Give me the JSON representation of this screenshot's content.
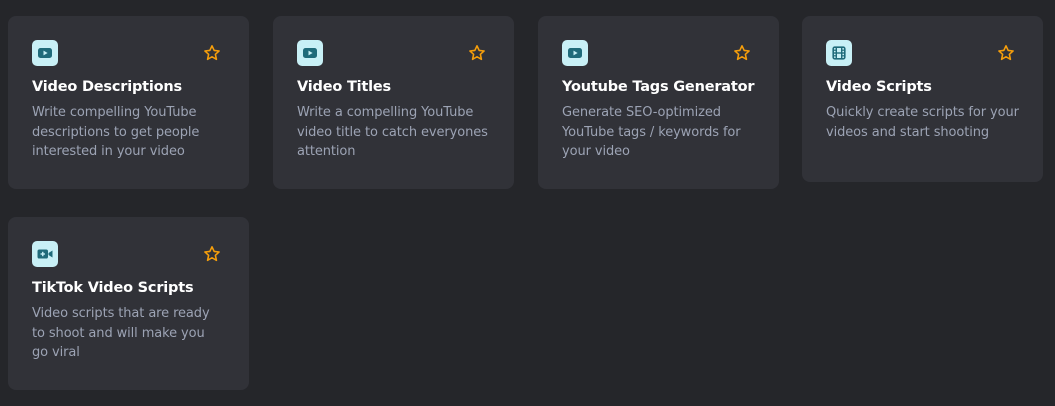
{
  "accent_color": "#f59e0b",
  "icon_bg_color": "#c8f0f6",
  "cards": [
    {
      "title": "Video Descriptions",
      "description_lines": [
        "Write compelling YouTube",
        "descriptions to get people",
        "interested in your video"
      ],
      "icon": "youtube-play-icon",
      "favorite_icon": "star-outline-icon"
    },
    {
      "title": "Video Titles",
      "description_lines": [
        "Write a compelling YouTube",
        "video title to catch everyones",
        "attention"
      ],
      "icon": "youtube-play-icon",
      "favorite_icon": "star-outline-icon"
    },
    {
      "title": "Youtube Tags Generator",
      "description_lines": [
        "Generate SEO-optimized",
        "YouTube tags / keywords for",
        "your video"
      ],
      "icon": "youtube-play-icon",
      "favorite_icon": "star-outline-icon"
    },
    {
      "title": "Video Scripts",
      "description_lines": [
        "Quickly create scripts for your",
        "videos and start shooting"
      ],
      "icon": "film-icon",
      "favorite_icon": "star-outline-icon"
    },
    {
      "title": "TikTok Video Scripts",
      "description_lines": [
        "Video scripts that are ready",
        "to shoot and will make you",
        "go viral"
      ],
      "icon": "video-camera-icon",
      "favorite_icon": "star-outline-icon"
    }
  ]
}
